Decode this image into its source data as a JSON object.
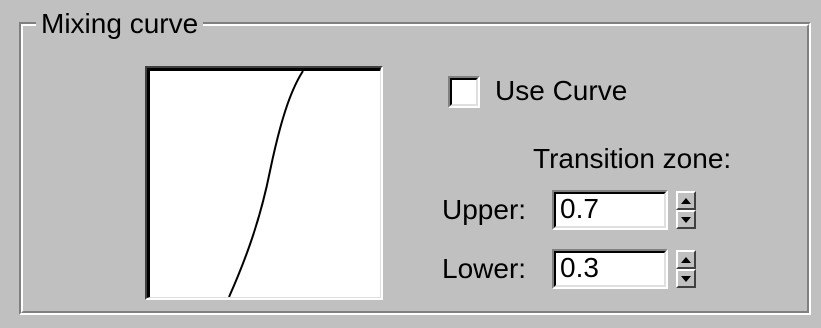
{
  "group": {
    "title": "Mixing curve"
  },
  "curve_preview": {
    "description_icon": "mixing-curve-graph",
    "line_color": "#000000",
    "background_color": "#ffffff"
  },
  "use_curve": {
    "label": "Use Curve",
    "checked": false
  },
  "transition_zone": {
    "title": "Transition zone:",
    "upper": {
      "label": "Upper:",
      "value": "0.7"
    },
    "lower": {
      "label": "Lower:",
      "value": "0.3"
    }
  },
  "colors": {
    "dialog_background": "#c0c0c0",
    "field_background": "#ffffff"
  }
}
